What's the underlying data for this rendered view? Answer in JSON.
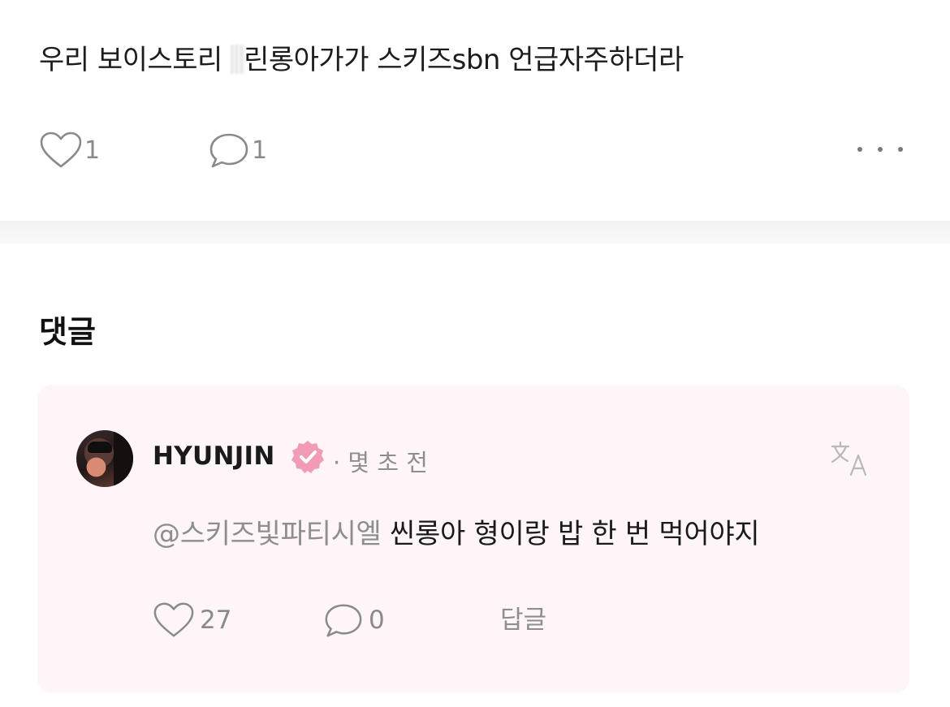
{
  "post": {
    "text_before_mask": "우리 보이스토리 ",
    "text_after_mask": "린롱아가가 스키즈sbn 언급자주하더라",
    "likes": "1",
    "comments": "1"
  },
  "comments_section": {
    "title": "댓글"
  },
  "comment": {
    "username": "HYUNJIN",
    "timestamp": "· 몇 초 전",
    "mention": "@스키즈빛파티시엘",
    "body": " 씬롱아 형이랑 밥 한 번 먹어야지",
    "likes": "27",
    "replies": "0",
    "reply_label": "답글"
  },
  "colors": {
    "card_background": "#fdf5f7",
    "verified_badge": "#f29bb4",
    "muted_text": "#8e8e8e"
  },
  "icons": {
    "like": "heart-outline-icon",
    "comment": "speech-bubble-outline-icon",
    "more": "more-horizontal-icon",
    "verified": "verified-badge-icon",
    "translate": "translate-icon"
  }
}
